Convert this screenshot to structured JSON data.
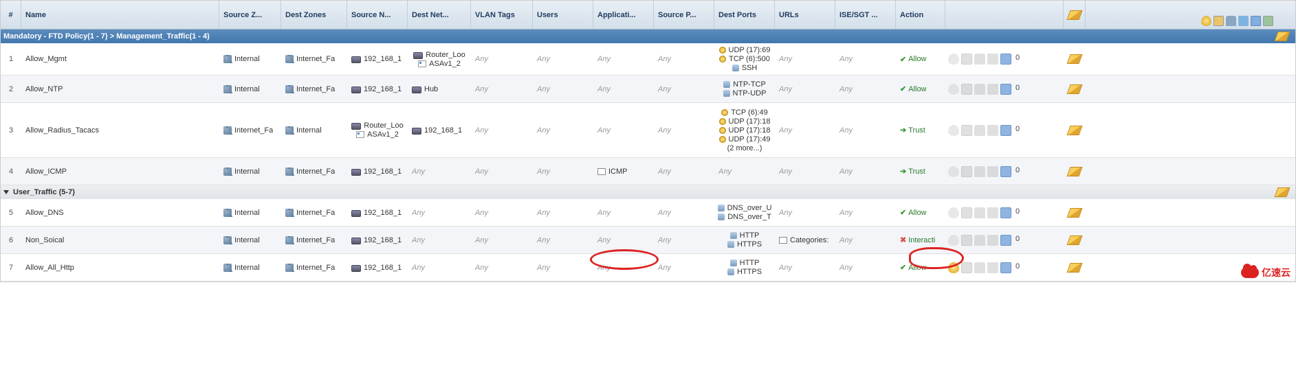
{
  "headers": {
    "num": "#",
    "name": "Name",
    "srczone": "Source Z...",
    "dstzone": "Dest Zones",
    "srcnet": "Source N...",
    "dstnet": "Dest Net...",
    "vlan": "VLAN Tags",
    "users": "Users",
    "app": "Applicati...",
    "srcport": "Source P...",
    "dstport": "Dest Ports",
    "urls": "URLs",
    "ise": "ISE/SGT ...",
    "action": "Action"
  },
  "sections": {
    "s1": "Mandatory - FTD Policy(1 - 7) > Management_Traffic(1 - 4)",
    "s2": "User_Traffic (5-7)"
  },
  "any": "Any",
  "actions": {
    "allow": "Allow",
    "trust": "Trust",
    "interact": "Interacti"
  },
  "count": "0",
  "rows": {
    "r1": {
      "num": "1",
      "name": "Allow_Mgmt",
      "srczone": "Internal",
      "dstzone": "Internet_Fa",
      "srcnet": "192_168_1",
      "dstnet1": "Router_Loo",
      "dstnet2": "ASAv1_2",
      "dp1": "UDP (17):69",
      "dp2": "TCP (6):500",
      "dp3": "SSH"
    },
    "r2": {
      "num": "2",
      "name": "Allow_NTP",
      "srczone": "Internal",
      "dstzone": "Internet_Fa",
      "srcnet": "192_168_1",
      "dstnet": "Hub",
      "dp1": "NTP-TCP",
      "dp2": "NTP-UDP"
    },
    "r3": {
      "num": "3",
      "name": "Allow_Radius_Tacacs",
      "srczone": "Internet_Fa",
      "dstzone": "Internal",
      "srcnet1": "Router_Loo",
      "srcnet2": "ASAv1_2",
      "dstnet": "192_168_1",
      "dp1": "TCP (6):49",
      "dp2": "UDP (17):18",
      "dp3": "UDP (17):18",
      "dp4": "UDP (17):49",
      "more": "(2 more...)"
    },
    "r4": {
      "num": "4",
      "name": "Allow_ICMP",
      "srczone": "Internal",
      "dstzone": "Internet_Fa",
      "srcnet": "192_168_1",
      "app": "ICMP"
    },
    "r5": {
      "num": "5",
      "name": "Allow_DNS",
      "srczone": "Internal",
      "dstzone": "Internet_Fa",
      "srcnet": "192_168_1",
      "dp1": "DNS_over_U",
      "dp2": "DNS_over_T"
    },
    "r6": {
      "num": "6",
      "name": "Non_Soical",
      "srczone": "Internal",
      "dstzone": "Internet_Fa",
      "srcnet": "192_168_1",
      "url": "Categories:",
      "dp1": "HTTP",
      "dp2": "HTTPS"
    },
    "r7": {
      "num": "7",
      "name": "Allow_All_Http",
      "srczone": "Internal",
      "dstzone": "Internet_Fa",
      "srcnet": "192_168_1",
      "dp1": "HTTP",
      "dp2": "HTTPS"
    }
  },
  "watermark": "亿速云"
}
